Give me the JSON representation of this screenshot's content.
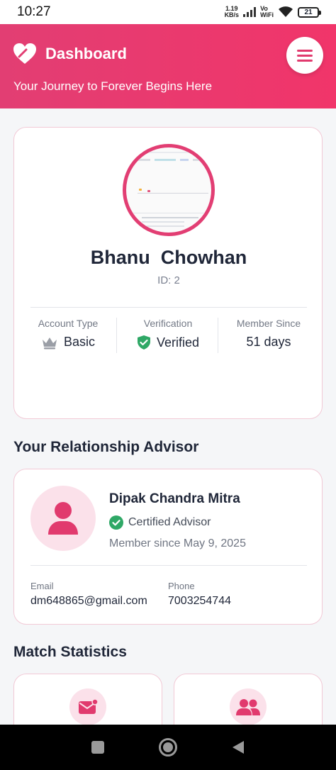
{
  "status_bar": {
    "time": "10:27",
    "net_speed_value": "1.19",
    "net_speed_unit": "KB/s",
    "vo_label": "Vo",
    "wifi_label": "WiFi",
    "battery": "21"
  },
  "header": {
    "title": "Dashboard",
    "subtitle": "Your Journey to Forever Begins Here",
    "brand_icon": "heart-icon",
    "menu_icon": "hamburger-menu-icon",
    "accent_color": "#e23e73"
  },
  "profile": {
    "name": "Bhanu  Chowhan",
    "id_text": "ID: 2",
    "stats": [
      {
        "label": "Account Type",
        "value": "Basic",
        "icon": "crown-icon"
      },
      {
        "label": "Verification",
        "value": "Verified",
        "icon": "shield-check-icon"
      },
      {
        "label": "Member Since",
        "value": "51 days"
      }
    ]
  },
  "advisor_section": {
    "title": "Your Relationship Advisor",
    "name": "Dipak Chandra Mitra",
    "certified": "Certified Advisor",
    "member_since": "Member since May 9, 2025",
    "email_label": "Email",
    "email": "dm648865@gmail.com",
    "phone_label": "Phone",
    "phone": "7003254744"
  },
  "match_stats": {
    "title": "Match Statistics",
    "cards": [
      {
        "icon": "mail-notification-icon"
      },
      {
        "icon": "users-icon"
      }
    ]
  }
}
